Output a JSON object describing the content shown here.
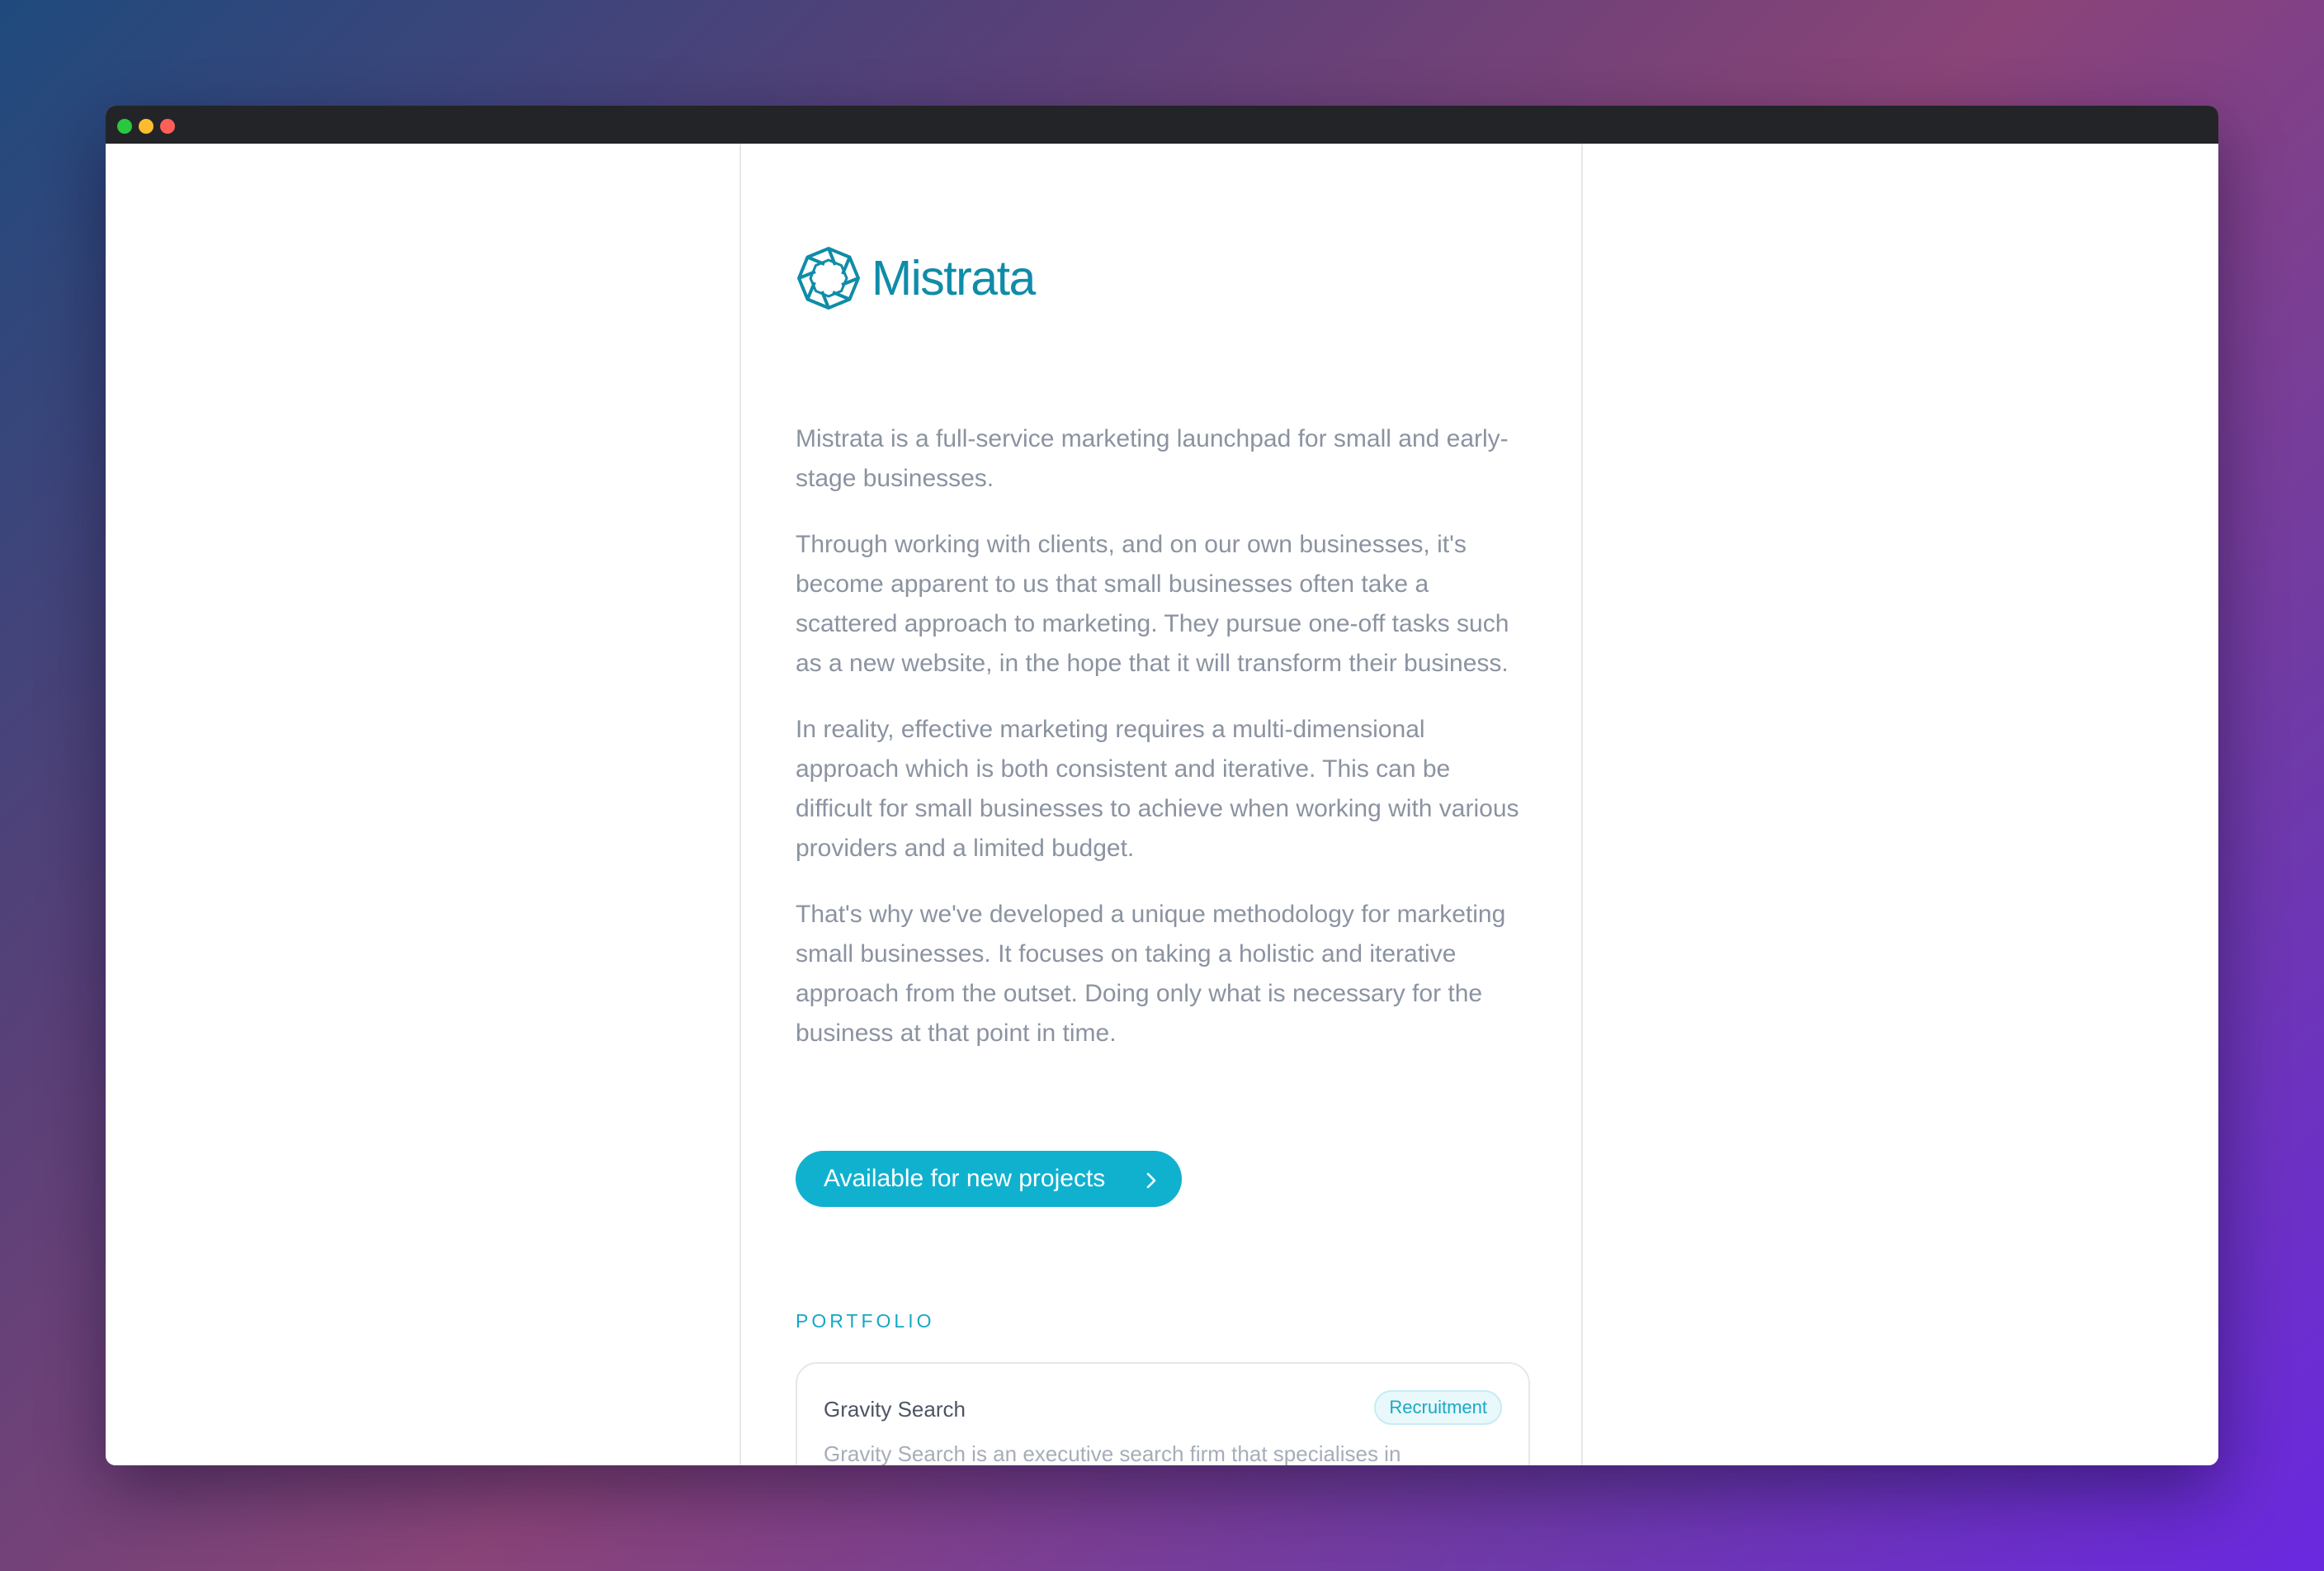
{
  "window": {
    "controls": [
      "green",
      "yellow",
      "red"
    ]
  },
  "brand": {
    "name": "Mistrata",
    "logo_icon": "octagon-knot-logo",
    "color": "#0f8ca8"
  },
  "intro": {
    "paragraphs": [
      "Mistrata is a full-service marketing launchpad for small and early-stage businesses.",
      "Through working with clients, and on our own businesses, it's become apparent to us that small businesses often take a scattered approach to marketing. They pursue one-off tasks such as a new website, in the hope that it will transform their business.",
      "In reality, effective marketing requires a multi-dimensional approach which is both consistent and iterative. This can be difficult for small businesses to achieve when working with various providers and a limited budget.",
      "That's why we've developed a unique methodology for marketing small businesses. It focuses on taking a holistic and iterative approach from the outset. Doing only what is necessary for the business at that point in time."
    ]
  },
  "cta": {
    "label": "Available for new projects",
    "icon": "chevron-right-icon",
    "color": "#10b1cf"
  },
  "portfolio": {
    "label": "PORTFOLIO",
    "items": [
      {
        "title": "Gravity Search",
        "tag": "Recruitment",
        "description": "Gravity Search is an executive search firm that specialises in"
      }
    ]
  }
}
